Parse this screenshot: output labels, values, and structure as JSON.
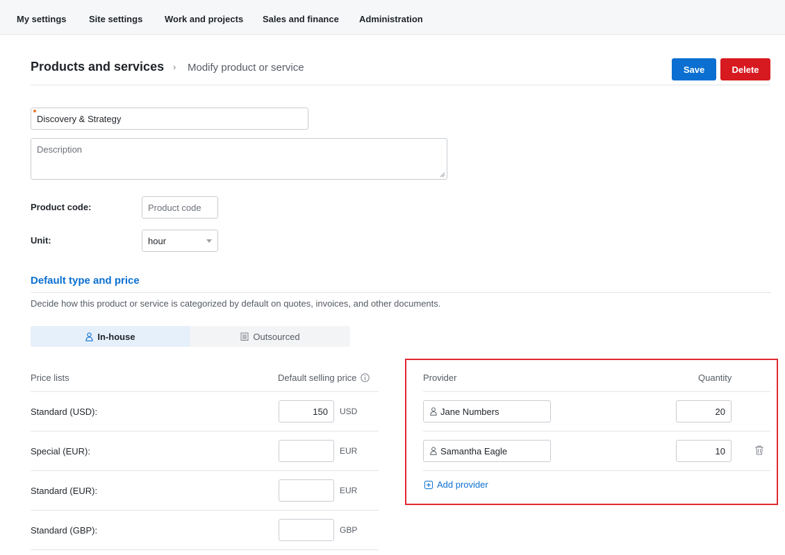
{
  "topnav": {
    "items": [
      {
        "label": "My settings"
      },
      {
        "label": "Site settings"
      },
      {
        "label": "Work and projects"
      },
      {
        "label": "Sales and finance"
      },
      {
        "label": "Administration"
      }
    ]
  },
  "header": {
    "title": "Products and services",
    "breadcrumb_separator": "›",
    "subtitle": "Modify product or service",
    "save_label": "Save",
    "delete_label": "Delete"
  },
  "form": {
    "name_value": "Discovery & Strategy",
    "description_placeholder": "Description",
    "product_code_label": "Product code:",
    "product_code_placeholder": "Product code",
    "unit_label": "Unit:",
    "unit_value": "hour"
  },
  "default_type": {
    "title": "Default type and price",
    "description": "Decide how this product or service is categorized by default on quotes, invoices, and other documents.",
    "options": [
      {
        "label": "In-house",
        "icon": "person-icon",
        "active": true
      },
      {
        "label": "Outsourced",
        "icon": "building-icon",
        "active": false
      }
    ]
  },
  "price_lists": {
    "col_list": "Price lists",
    "col_price": "Default selling price",
    "rows": [
      {
        "label": "Standard (USD):",
        "value": "150",
        "currency": "USD"
      },
      {
        "label": "Special (EUR):",
        "value": "",
        "currency": "EUR"
      },
      {
        "label": "Standard (EUR):",
        "value": "",
        "currency": "EUR"
      },
      {
        "label": "Standard (GBP):",
        "value": "",
        "currency": "GBP"
      }
    ]
  },
  "providers": {
    "col_provider": "Provider",
    "col_quantity": "Quantity",
    "rows": [
      {
        "name": "Jane Numbers",
        "quantity": "20"
      },
      {
        "name": "Samantha Eagle",
        "quantity": "10"
      }
    ],
    "add_label": "Add provider"
  },
  "colors": {
    "accent": "#0a6fd1",
    "danger": "#d71920",
    "highlight": "#e0282e"
  }
}
